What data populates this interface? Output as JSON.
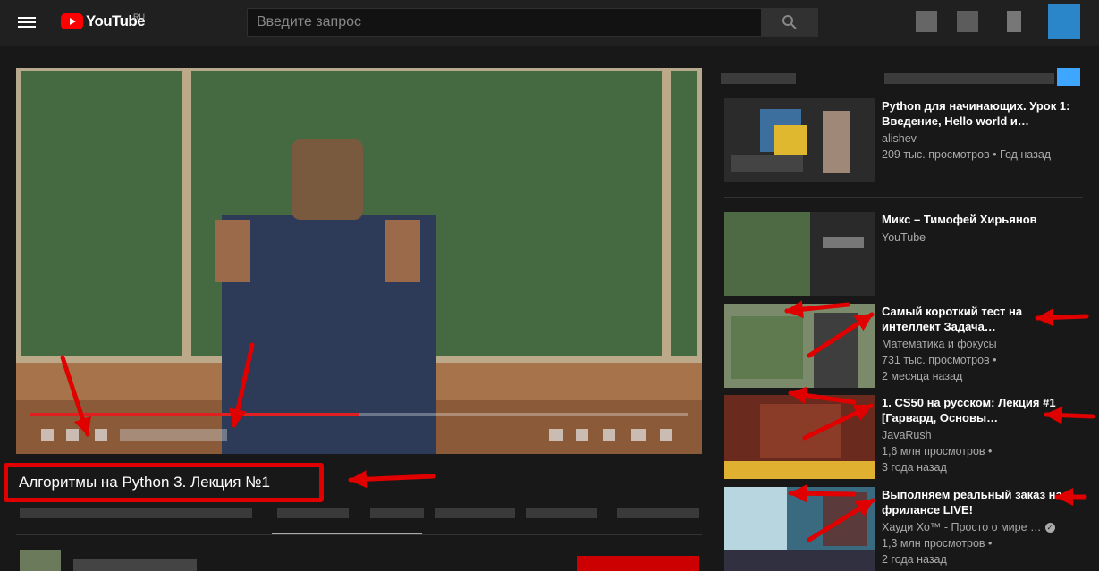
{
  "header": {
    "logo_text": "YouTube",
    "region": "RU",
    "search_placeholder": "Введите запрос"
  },
  "player": {
    "progress": 0.5,
    "accent": "#ff0000"
  },
  "video": {
    "title": "Алгоритмы на Python 3. Лекция №1"
  },
  "recommendations": [
    {
      "title": "Python для начинающих. Урок 1: Введение, Hello world и…",
      "channel": "alishev",
      "stats": "209 тыс. просмотров • Год назад"
    },
    {
      "title": "Микс – Тимофей Хирьянов",
      "channel": "YouTube"
    },
    {
      "title": "Самый короткий тест на интеллект Задача…",
      "channel": "Математика и фокусы",
      "views": "731 тыс. просмотров •",
      "age": "2 месяца назад"
    },
    {
      "title": "1. CS50 на русском: Лекция #1 [Гарвард, Основы…",
      "channel": "JavaRush",
      "views": "1,6 млн просмотров •",
      "age": "3 года назад"
    },
    {
      "title": "Выполняем реальный заказ на фрилансе LIVE!",
      "channel": "Хауди Хо™ - Просто о мире …",
      "views": "1,3 млн просмотров •",
      "age": "2 года назад"
    }
  ],
  "colors": {
    "background": "#181818",
    "annotation": "#e00000",
    "link_blue": "#3ea6ff"
  }
}
